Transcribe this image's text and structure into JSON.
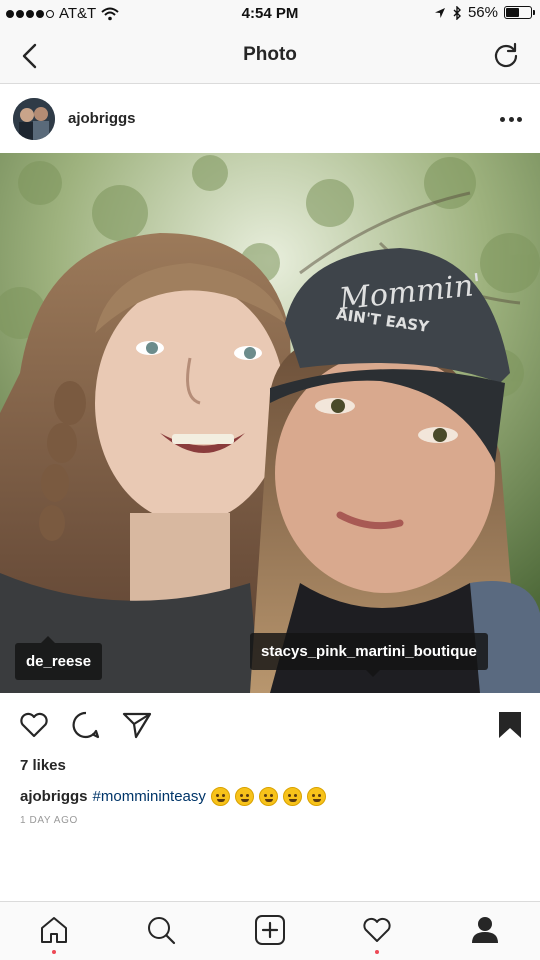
{
  "status_bar": {
    "carrier": "AT&T",
    "time": "4:54 PM",
    "battery": "56%",
    "battery_level": 0.56
  },
  "nav": {
    "title": "Photo",
    "back_icon": "chevron-left-icon",
    "refresh_icon": "refresh-icon"
  },
  "post": {
    "username": "ajobriggs",
    "tags": [
      {
        "label": "de_reese"
      },
      {
        "label": "stacys_pink_martini_boutique"
      }
    ],
    "likes": "7 likes",
    "caption_user": "ajobriggs",
    "caption_hashtag": "#mommininteasy",
    "time_ago": "1 DAY AGO",
    "hat_text_line1": "Mommin'",
    "hat_text_line2": "AIN'T EASY"
  },
  "tab_bar": {
    "items": [
      "home-icon",
      "search-icon",
      "add-icon",
      "heart-icon",
      "profile-icon"
    ]
  },
  "colors": {
    "accent_blue": "#003569",
    "notification_red": "#ed4956",
    "text": "#262626"
  }
}
